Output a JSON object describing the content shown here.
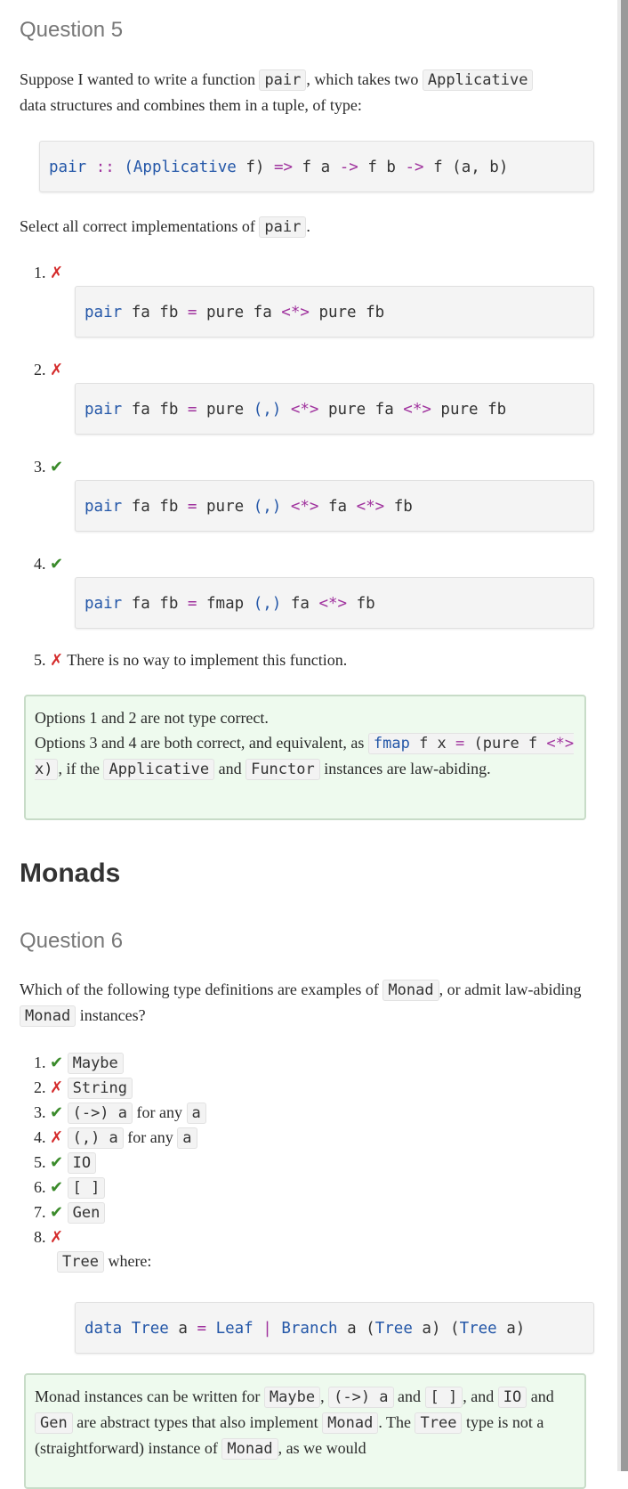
{
  "q5": {
    "heading": "Question 5",
    "intro_1": "Suppose I wanted to write a function ",
    "intro_code_1": "pair",
    "intro_2": ", which takes two ",
    "intro_code_2": "Applicative",
    "intro_3": "data structures and combines them in a tuple, of type:",
    "sig": {
      "name": "pair",
      "dc": "::",
      "p1": "(",
      "cls": "Applicative",
      "rest1": " f) ",
      "arrow1": "=>",
      "rest2": " f a ",
      "arrow2": "->",
      "rest3": " f b ",
      "arrow3": "->",
      "rest4": " f (a, b)"
    },
    "select_text": "Select all correct implementations of ",
    "select_code": "pair",
    "select_end": ".",
    "options": [
      {
        "num": "1.",
        "mark": "✗",
        "correct": false,
        "code": "pair fa fb = pure fa <*> pure fb"
      },
      {
        "num": "2.",
        "mark": "✗",
        "correct": false,
        "code": "pair fa fb = pure (,) <*> pure fa <*> pure fb"
      },
      {
        "num": "3.",
        "mark": "✔",
        "correct": true,
        "code": "pair fa fb = pure (,) <*> fa <*> fb"
      },
      {
        "num": "4.",
        "mark": "✔",
        "correct": true,
        "code": "pair fa fb = fmap (,) fa <*> fb"
      }
    ],
    "option5": {
      "num": "5.",
      "mark": "✗",
      "text": "There is no way to implement this function."
    },
    "answer": {
      "line1": "Options 1 and 2 are not type correct.",
      "l2a": "Options 3 and 4 are both correct, and equivalent, as ",
      "l2code": "fmap f x = (pure f <*> x)",
      "l2b": ", if the ",
      "l2code2": "Applicative",
      "l2c": " and ",
      "l2code3": "Functor",
      "l2d": " instances are law-abiding."
    }
  },
  "monads": {
    "heading": "Monads",
    "q6": {
      "heading": "Question 6",
      "intro_1": "Which of the following type definitions are examples of ",
      "intro_code_1": "Monad",
      "intro_2": ", or admit law-abiding ",
      "intro_code_2": "Monad",
      "intro_3": " instances?",
      "items": [
        {
          "num": "1.",
          "mark": "✔",
          "correct": true,
          "code": "Maybe",
          "suffix": "",
          "code2": ""
        },
        {
          "num": "2.",
          "mark": "✗",
          "correct": false,
          "code": "String",
          "suffix": "",
          "code2": ""
        },
        {
          "num": "3.",
          "mark": "✔",
          "correct": true,
          "code": "(->) a",
          "suffix": " for any ",
          "code2": "a"
        },
        {
          "num": "4.",
          "mark": "✗",
          "correct": false,
          "code": "(,) a",
          "suffix": " for any ",
          "code2": "a"
        },
        {
          "num": "5.",
          "mark": "✔",
          "correct": true,
          "code": "IO",
          "suffix": "",
          "code2": ""
        },
        {
          "num": "6.",
          "mark": "✔",
          "correct": true,
          "code": "[ ]",
          "suffix": "",
          "code2": ""
        },
        {
          "num": "7.",
          "mark": "✔",
          "correct": true,
          "code": "Gen",
          "suffix": "",
          "code2": ""
        }
      ],
      "item8": {
        "num": "8.",
        "mark": "✗",
        "code": "Tree",
        "text": " where:"
      },
      "tree_def": {
        "kw": "data",
        "t1": "Tree",
        "a": " a ",
        "eq": "=",
        "leaf": "Leaf",
        "bar": "|",
        "branch": "Branch",
        "rest": " a (",
        "t2": "Tree",
        "rest2": " a) (",
        "t3": "Tree",
        "rest3": " a)"
      },
      "answer": {
        "a1": "Monad instances can be written for ",
        "c1": "Maybe",
        "a2": ", ",
        "c2": "(->) a",
        "a3": " and ",
        "c3": "[ ]",
        "a4": ", and ",
        "c4": "IO",
        "a5": " and ",
        "c5": "Gen",
        "a6": " are abstract types that also implement ",
        "c6": "Monad",
        "a7": ". The ",
        "c7": "Tree",
        "a8": " type is not a (straightforward) instance of ",
        "c8": "Monad",
        "a9": ", as we would"
      }
    }
  }
}
